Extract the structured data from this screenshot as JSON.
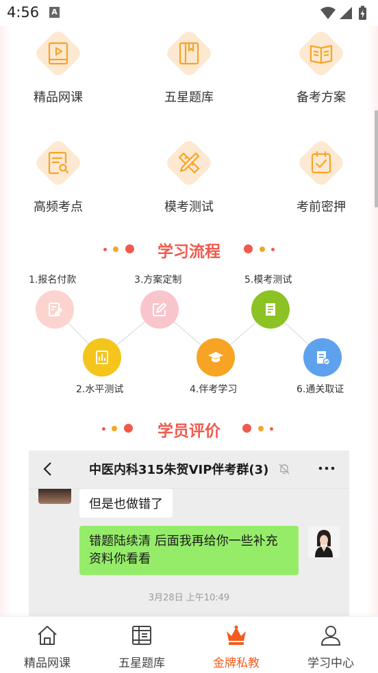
{
  "status_bar": {
    "time": "4:56",
    "notification_letter": "A"
  },
  "features": [
    {
      "label": "精品网课",
      "icon": "video-book-icon"
    },
    {
      "label": "五星题库",
      "icon": "question-bank-icon"
    },
    {
      "label": "备考方案",
      "icon": "open-book-icon"
    },
    {
      "label": "高频考点",
      "icon": "note-search-icon"
    },
    {
      "label": "模考测试",
      "icon": "ruler-pencil-icon"
    },
    {
      "label": "考前密押",
      "icon": "checklist-icon"
    }
  ],
  "process": {
    "title": "学习流程",
    "steps": [
      {
        "label": "1.报名付款",
        "icon": "edit-form-icon",
        "color": "#fcd4cf"
      },
      {
        "label": "2.水平测试",
        "icon": "chart-icon",
        "color": "#f5c51b"
      },
      {
        "label": "3.方案定制",
        "icon": "pencil-square-icon",
        "color": "#f9c5cc"
      },
      {
        "label": "4.伴考学习",
        "icon": "graduation-cap-icon",
        "color": "#f7a424"
      },
      {
        "label": "5.模考测试",
        "icon": "document-icon",
        "color": "#8cc223"
      },
      {
        "label": "6.通关取证",
        "icon": "certificate-icon",
        "color": "#5ea2ee"
      }
    ]
  },
  "reviews": {
    "title": "学员评价",
    "chat": {
      "title": "中医内科315朱贺VIP伴考群(3)",
      "back_icon": "chevron-left-icon",
      "mute_icon": "bell-off-icon",
      "more_icon": "more-dots-icon",
      "message_left": "但是也做错了",
      "message_right": "错题陆续清 后面我再给你一些补充资料你看看",
      "timestamp": "3月28日 上午10:49"
    }
  },
  "tabbar": {
    "active_color": "#f35b1c",
    "items": [
      {
        "label": "精品网课",
        "icon": "home-icon"
      },
      {
        "label": "五星题库",
        "icon": "book-icon"
      },
      {
        "label": "金牌私教",
        "icon": "crown-icon",
        "active": true
      },
      {
        "label": "学习中心",
        "icon": "user-icon"
      }
    ]
  },
  "colors": {
    "accent": "#f05a4e",
    "icon_orange": "#f7a424",
    "chat_bubble": "#95ec69"
  }
}
